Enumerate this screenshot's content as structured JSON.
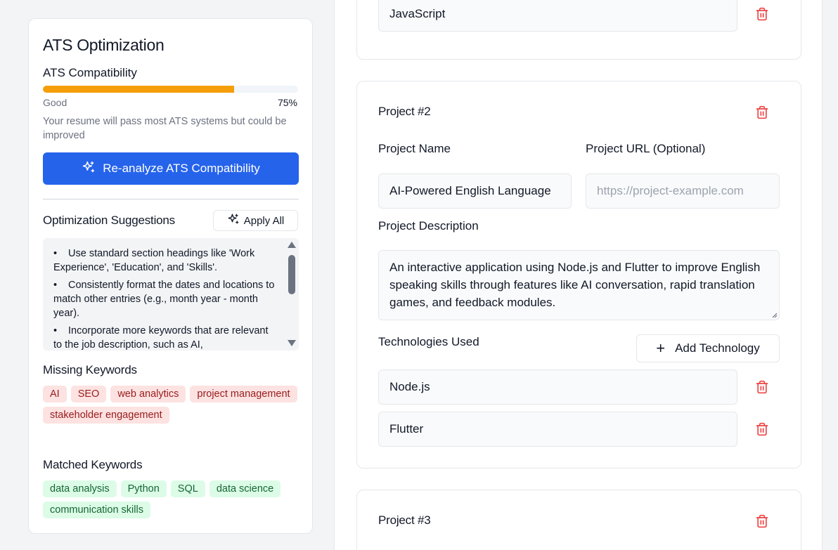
{
  "ats": {
    "title": "ATS Optimization",
    "compatibility_label": "ATS Compatibility",
    "score_percent": 75,
    "score_text": "75%",
    "status": "Good",
    "message": "Your resume will pass most ATS systems but could be improved",
    "reanalyze_label": "Re-analyze ATS Compatibility",
    "suggestions_title": "Optimization Suggestions",
    "apply_all_label": "Apply All",
    "suggestions": [
      "Use standard section headings like 'Work Experience', 'Education', and 'Skills'.",
      "Consistently format the dates and locations to match other entries (e.g., month year - month year).",
      "Incorporate more keywords that are relevant to the job description, such as AI,"
    ],
    "missing_keywords_title": "Missing Keywords",
    "missing_keywords": [
      "AI",
      "SEO",
      "web analytics",
      "project management",
      "stakeholder engagement"
    ],
    "matched_keywords_title": "Matched Keywords",
    "matched_keywords": [
      "data analysis",
      "Python",
      "SQL",
      "data science",
      "communication skills"
    ],
    "colors": {
      "accent": "#2563eb",
      "progress": "#f59e0b",
      "missing_bg": "#fde2e2",
      "matched_bg": "#dcfce7"
    }
  },
  "projects": {
    "previous_technology": "JavaScript",
    "project2": {
      "heading": "Project #2",
      "name_label": "Project Name",
      "name_value": "AI-Powered English Language",
      "url_label": "Project URL (Optional)",
      "url_placeholder": "https://project-example.com",
      "description_label": "Project Description",
      "description_value": "An interactive application using Node.js and Flutter to improve English speaking skills through features like AI conversation, rapid translation games, and feedback modules.",
      "technologies_label": "Technologies Used",
      "add_technology_label": "Add Technology",
      "add_icon": "+",
      "technologies": [
        "Node.js",
        "Flutter"
      ]
    },
    "project3": {
      "heading": "Project #3"
    }
  }
}
